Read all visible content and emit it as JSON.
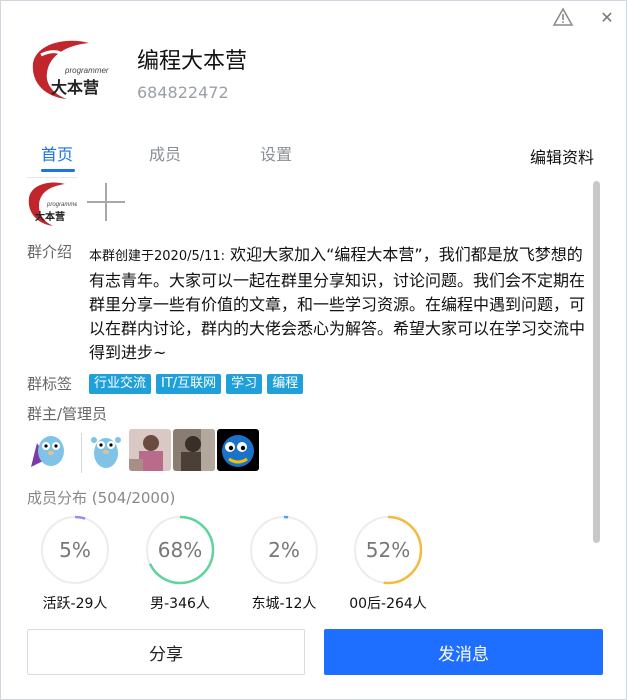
{
  "window": {
    "warn_icon": "warning-triangle-icon",
    "close_icon": "close-icon",
    "close_glyph": "✕"
  },
  "group": {
    "name": "编程大本营",
    "id": "684822472",
    "logo_text_main": "大本营",
    "logo_text_side": "programmer"
  },
  "tabs": [
    {
      "label": "首页",
      "active": true
    },
    {
      "label": "成员",
      "active": false
    },
    {
      "label": "设置",
      "active": false
    }
  ],
  "edit_profile_label": "编辑资料",
  "intro": {
    "label": "群介绍",
    "prefix": "本群创建于2020/5/11:",
    "text": " 欢迎大家加入“编程大本营”，我们都是放飞梦想的有志青年。大家可以一起在群里分享知识，讨论问题。我们会不定期在群里分享一些有价值的文章，和一些学习资源。在编程中遇到问题，可以在群内讨论，群内的大佬会悉心为解答。希望大家可以在学习交流中得到进步~"
  },
  "tags": {
    "label": "群标签",
    "items": [
      "行业交流",
      "IT/互联网",
      "学习",
      "编程"
    ],
    "color": "#1fa0d9"
  },
  "admins": {
    "label": "群主/管理员",
    "avatars": [
      "gopher-caped-avatar",
      "gopher-avatar",
      "photo-avatar-1",
      "photo-avatar-2",
      "blue-dog-avatar"
    ]
  },
  "distribution": {
    "title": "成员分布",
    "count": "(504/2000)",
    "rings": [
      {
        "value": "5%",
        "fraction": 0.05,
        "caption": "活跃-29人",
        "color": "#9b8cf0"
      },
      {
        "value": "68%",
        "fraction": 0.68,
        "caption": "男-346人",
        "color": "#5fd39a"
      },
      {
        "value": "2%",
        "fraction": 0.02,
        "caption": "东城-12人",
        "color": "#4aa3f0"
      },
      {
        "value": "52%",
        "fraction": 0.52,
        "caption": "00后-264人",
        "color": "#f5b942"
      }
    ]
  },
  "buttons": {
    "share": "分享",
    "send": "发消息"
  },
  "colors": {
    "accent": "#1a73e8",
    "send_button": "#1e6fff"
  }
}
